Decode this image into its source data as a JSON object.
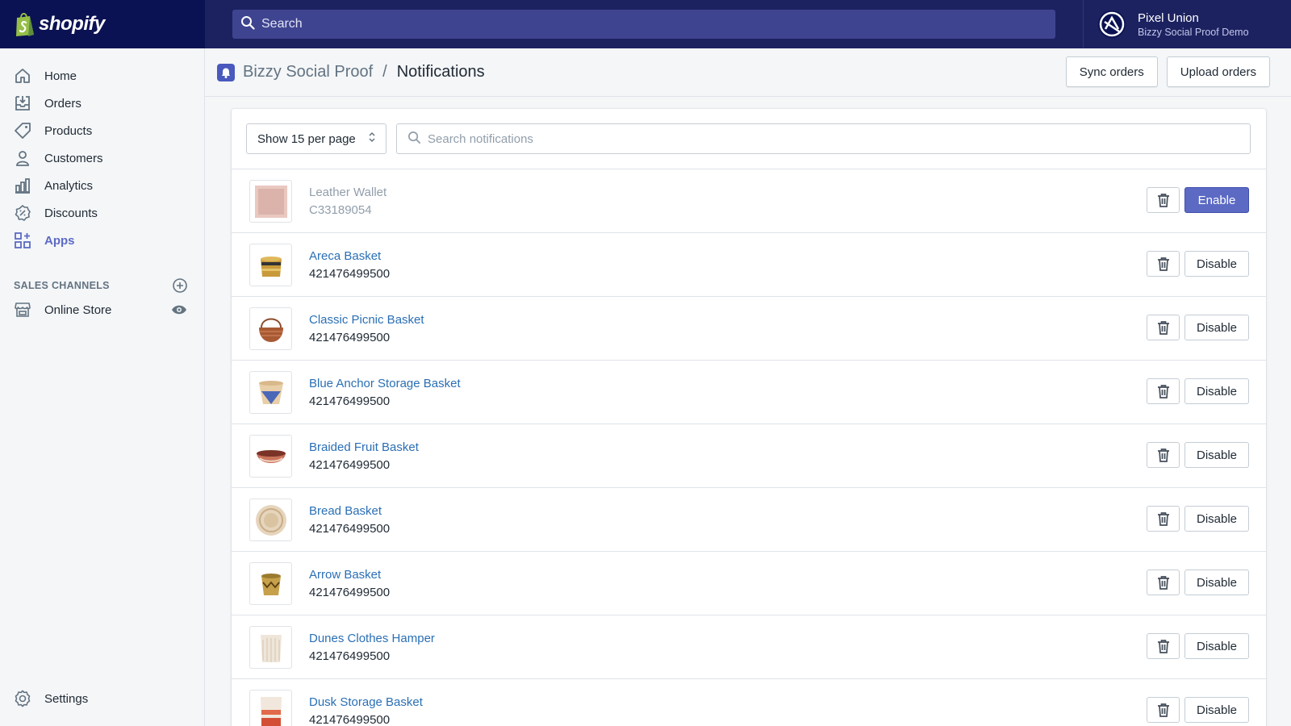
{
  "topbar": {
    "brand_name": "shopify",
    "brand_color": "#95bf47",
    "search_placeholder": "Search",
    "account_name": "Pixel Union",
    "account_store": "Bizzy Social Proof Demo"
  },
  "sidebar": {
    "items": [
      {
        "label": "Home",
        "icon": "home-icon"
      },
      {
        "label": "Orders",
        "icon": "orders-icon"
      },
      {
        "label": "Products",
        "icon": "tag-icon"
      },
      {
        "label": "Customers",
        "icon": "person-icon"
      },
      {
        "label": "Analytics",
        "icon": "bar-chart-icon"
      },
      {
        "label": "Discounts",
        "icon": "discount-icon"
      },
      {
        "label": "Apps",
        "icon": "apps-icon",
        "active": true
      }
    ],
    "sales_channels_title": "SALES CHANNELS",
    "online_store_label": "Online Store",
    "settings_label": "Settings"
  },
  "header": {
    "app_name": "Bizzy Social Proof",
    "separator": "/",
    "page_title": "Notifications",
    "sync_label": "Sync orders",
    "upload_label": "Upload orders"
  },
  "filters": {
    "per_page_label": "Show 15 per page",
    "search_placeholder": "Search notifications"
  },
  "colors": {
    "accent": "#5c6ac4",
    "link": "#2a6fb5",
    "topbar": "#1c2260"
  },
  "notifications": [
    {
      "title": "Leather Wallet",
      "sku": "C33189054",
      "action": "Enable",
      "enabled": false,
      "thumb": "wallet"
    },
    {
      "title": "Areca Basket",
      "sku": "421476499500",
      "action": "Disable",
      "enabled": true,
      "thumb": "areca"
    },
    {
      "title": "Classic Picnic Basket",
      "sku": "421476499500",
      "action": "Disable",
      "enabled": true,
      "thumb": "picnic"
    },
    {
      "title": "Blue Anchor Storage Basket",
      "sku": "421476499500",
      "action": "Disable",
      "enabled": true,
      "thumb": "anchor"
    },
    {
      "title": "Braided Fruit Basket",
      "sku": "421476499500",
      "action": "Disable",
      "enabled": true,
      "thumb": "fruit"
    },
    {
      "title": "Bread Basket",
      "sku": "421476499500",
      "action": "Disable",
      "enabled": true,
      "thumb": "bread"
    },
    {
      "title": "Arrow Basket",
      "sku": "421476499500",
      "action": "Disable",
      "enabled": true,
      "thumb": "arrow"
    },
    {
      "title": "Dunes Clothes Hamper",
      "sku": "421476499500",
      "action": "Disable",
      "enabled": true,
      "thumb": "hamper"
    },
    {
      "title": "Dusk Storage Basket",
      "sku": "421476499500",
      "action": "Disable",
      "enabled": true,
      "thumb": "dusk"
    }
  ]
}
